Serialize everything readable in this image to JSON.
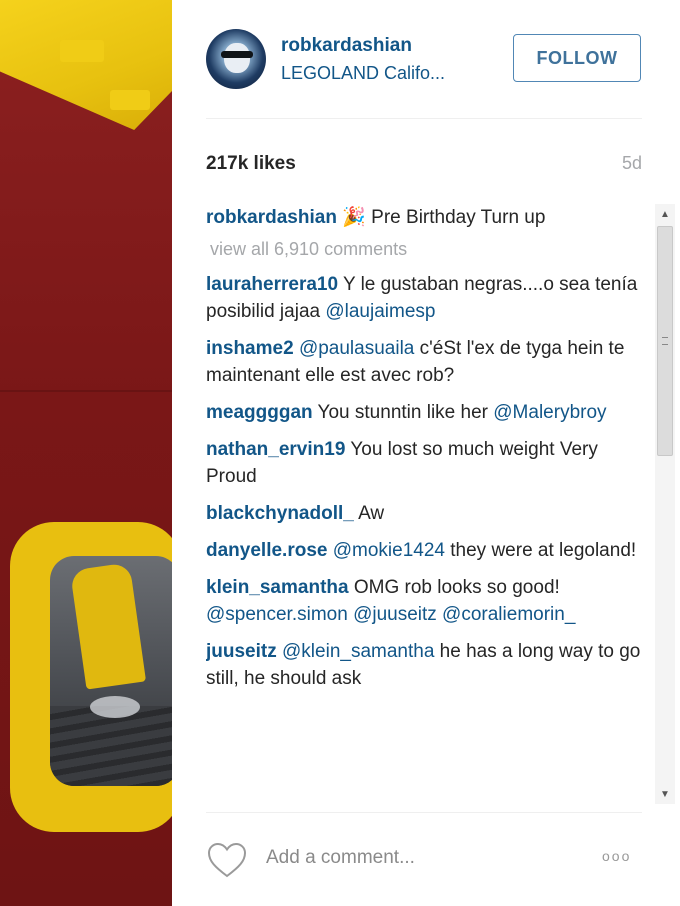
{
  "post": {
    "username": "robkardashian",
    "location": "LEGOLAND Califo...",
    "follow_label": "FOLLOW",
    "likes": "217k likes",
    "time_ago": "5d",
    "caption_user": "robkardashian",
    "caption_emoji": "🎉",
    "caption_text": " Pre Birthday Turn up",
    "view_all": "view all 6,910 comments"
  },
  "comments": [
    {
      "user": "lauraherrera10",
      "text": " Y le gustaban negras....o sea tenía posibilid jajaa ",
      "mention": "@laujaimesp",
      "tail": ""
    },
    {
      "user": "inshame2",
      "text": " ",
      "mention": "@paulasuaila",
      "tail": " c'éSt l'ex de tyga hein te maintenant elle est avec rob?"
    },
    {
      "user": "meaggggan",
      "text": " You stunntin like her ",
      "mention": "@Malerybroy",
      "tail": ""
    },
    {
      "user": "nathan_ervin19",
      "text": " You lost so much weight Very Proud",
      "mention": "",
      "tail": ""
    },
    {
      "user": "blackchynadoll_",
      "text": " Aw",
      "mention": "",
      "tail": ""
    },
    {
      "user": "danyelle.rose",
      "text": " ",
      "mention": "@mokie1424",
      "tail": " they were at legoland!"
    },
    {
      "user": "klein_samantha",
      "text": " OMG rob looks so good! ",
      "mention": "@spencer.simon @juuseitz @coraliemorin_",
      "tail": ""
    },
    {
      "user": "juuseitz",
      "text": " ",
      "mention": "@klein_samantha",
      "tail": " he has a long way to go still, he should ask"
    }
  ],
  "footer": {
    "comment_placeholder": "Add a comment...",
    "more_icon": "ooo"
  },
  "scrollbar": {
    "up": "▲",
    "down": "▼"
  },
  "colors": {
    "link": "#125688",
    "follow": "#3f729b",
    "muted": "#a5a7aa"
  }
}
